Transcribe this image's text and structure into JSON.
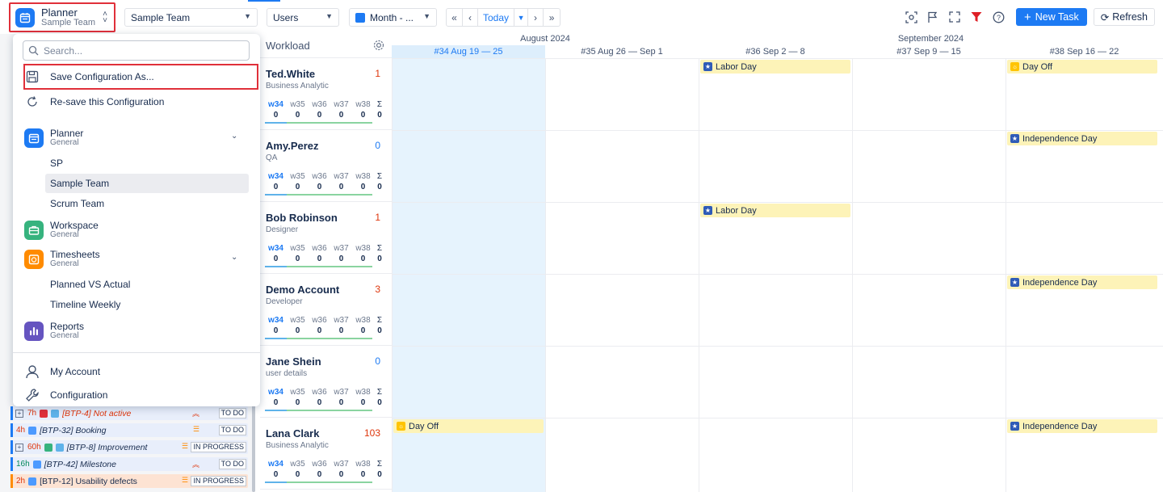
{
  "app_switcher": {
    "title": "Planner",
    "subtitle": "Sample Team"
  },
  "toolbar": {
    "team_select": "Sample Team",
    "view_select": "Users",
    "period_select": "Month - ...",
    "today_label": "Today",
    "new_task_label": "New Task",
    "refresh_label": "Refresh"
  },
  "dropdown": {
    "search_placeholder": "Search...",
    "save_as_label": "Save Configuration As...",
    "resave_label": "Re-save this Configuration",
    "apps": [
      {
        "name": "Planner",
        "category": "General",
        "color": "#1d7af3",
        "icon": "calendar-icon",
        "expanded": true
      },
      {
        "name": "Workspace",
        "category": "General",
        "color": "#36b37e",
        "icon": "briefcase-icon",
        "expanded": false
      },
      {
        "name": "Timesheets",
        "category": "General",
        "color": "#ff8b00",
        "icon": "clock-icon",
        "expanded": true
      },
      {
        "name": "Reports",
        "category": "General",
        "color": "#6554c0",
        "icon": "bar-chart-icon",
        "expanded": false
      }
    ],
    "planner_items": [
      "SP",
      "Sample Team",
      "Scrum Team"
    ],
    "timesheets_items": [
      "Planned VS Actual",
      "Timeline Weekly"
    ],
    "my_account_label": "My Account",
    "configuration_label": "Configuration"
  },
  "workload": {
    "header": "Workload",
    "week_labels": [
      "w34",
      "w35",
      "w36",
      "w37",
      "w38",
      "Σ"
    ],
    "users": [
      {
        "name": "Ted.White",
        "role": "Business Analytic",
        "count": "1",
        "count_color": "#de350b",
        "values": [
          "0",
          "0",
          "0",
          "0",
          "0",
          "0"
        ]
      },
      {
        "name": "Amy.Perez",
        "role": "QA",
        "count": "0",
        "count_color": "#1d7af3",
        "values": [
          "0",
          "0",
          "0",
          "0",
          "0",
          "0"
        ]
      },
      {
        "name": "Bob Robinson",
        "role": "Designer",
        "count": "1",
        "count_color": "#de350b",
        "values": [
          "0",
          "0",
          "0",
          "0",
          "0",
          "0"
        ]
      },
      {
        "name": "Demo Account",
        "role": "Developer",
        "count": "3",
        "count_color": "#de350b",
        "values": [
          "0",
          "0",
          "0",
          "0",
          "0",
          "0"
        ]
      },
      {
        "name": "Jane Shein",
        "role": "user details",
        "count": "0",
        "count_color": "#1d7af3",
        "values": [
          "0",
          "0",
          "0",
          "0",
          "0",
          "0"
        ]
      },
      {
        "name": "Lana Clark",
        "role": "Business Analytic",
        "count": "103",
        "count_color": "#de350b",
        "values": [
          "0",
          "0",
          "0",
          "0",
          "0",
          "0"
        ]
      }
    ]
  },
  "calendar": {
    "months": [
      "August 2024",
      "September 2024"
    ],
    "weeks": [
      "#34 Aug 19 — 25",
      "#35 Aug 26 — Sep 1",
      "#36 Sep 2 — 8",
      "#37 Sep 9 — 15",
      "#38 Sep 16 — 22"
    ],
    "events": [
      {
        "label": "Labor Day",
        "type": "holiday"
      },
      {
        "label": "Day Off",
        "type": "dayoff"
      },
      {
        "label": "Independence Day",
        "type": "holiday"
      },
      {
        "label": "Labor Day",
        "type": "holiday"
      },
      {
        "label": "Independence Day",
        "type": "holiday"
      },
      {
        "label": "Day Off",
        "type": "dayoff"
      },
      {
        "label": "Independence Day",
        "type": "holiday"
      }
    ]
  },
  "backlog": [
    {
      "hours": "7h",
      "key": "[BTP-4] Not active",
      "status": "TO DO",
      "color": "#de350b"
    },
    {
      "hours": "4h",
      "key": "[BTP-32] Booking",
      "status": "TO DO",
      "color": "#de350b"
    },
    {
      "hours": "60h",
      "key": "[BTP-8] Improvement",
      "status": "IN PROGRESS",
      "color": "#de350b"
    },
    {
      "hours": "16h",
      "key": "[BTP-42] Milestone",
      "status": "TO DO",
      "color": "#00875a"
    },
    {
      "hours": "2h",
      "key": "[BTP-12] Usability defects",
      "status": "IN PROGRESS",
      "color": "#de350b"
    }
  ]
}
